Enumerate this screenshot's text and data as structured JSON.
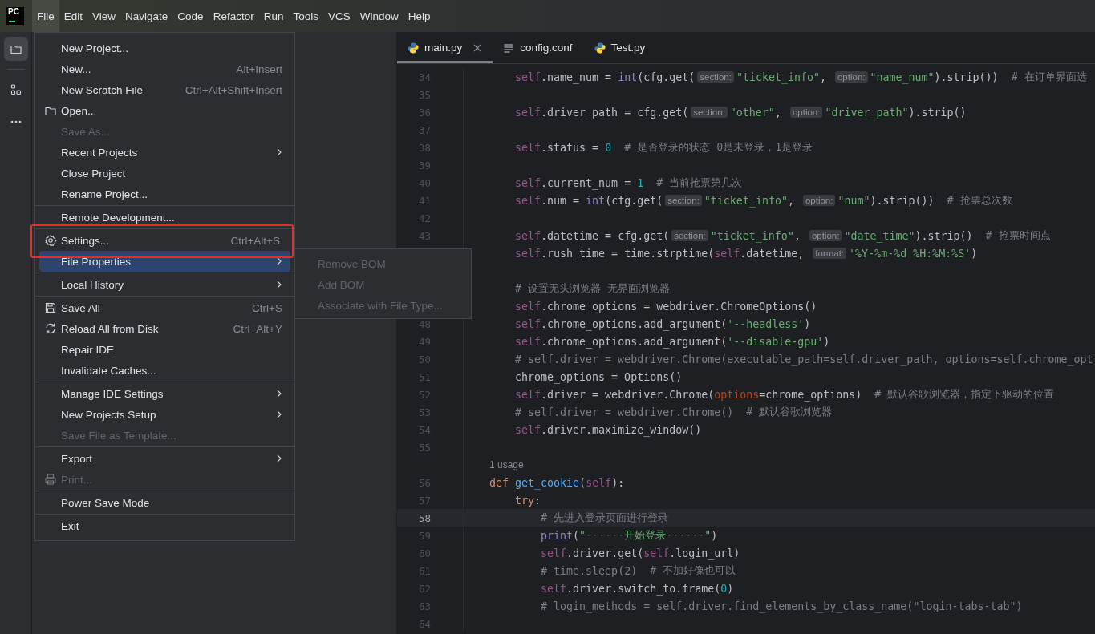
{
  "menu_bar": {
    "logo": "PC",
    "items": [
      {
        "label": "File",
        "selected": true
      },
      {
        "label": "Edit",
        "selected": false
      },
      {
        "label": "View",
        "selected": false
      },
      {
        "label": "Navigate",
        "selected": false
      },
      {
        "label": "Code",
        "selected": false
      },
      {
        "label": "Refactor",
        "selected": false
      },
      {
        "label": "Run",
        "selected": false
      },
      {
        "label": "Tools",
        "selected": false
      },
      {
        "label": "VCS",
        "selected": false
      },
      {
        "label": "Window",
        "selected": false
      },
      {
        "label": "Help",
        "selected": false
      }
    ]
  },
  "tool_strip": {
    "items": [
      {
        "kind": "folder",
        "selected": true
      },
      {
        "kind": "structure",
        "selected": false
      },
      {
        "kind": "more",
        "selected": false
      }
    ]
  },
  "file_menu": {
    "groups": [
      [
        {
          "label": "New Project...",
          "disabled": false,
          "submenu": false,
          "selected": false,
          "annotated": false
        },
        {
          "label": "New...",
          "shortcut": "Alt+Insert",
          "disabled": false,
          "submenu": false,
          "selected": false,
          "annotated": false
        },
        {
          "label": "New Scratch File",
          "shortcut": "Ctrl+Alt+Shift+Insert",
          "disabled": false,
          "submenu": false,
          "selected": false,
          "annotated": false
        },
        {
          "label": "Open...",
          "kind": "folder",
          "disabled": false,
          "submenu": false,
          "selected": false,
          "annotated": false
        },
        {
          "label": "Save As...",
          "disabled": true,
          "submenu": false,
          "selected": false,
          "annotated": false
        },
        {
          "label": "Recent Projects",
          "disabled": false,
          "submenu": true,
          "selected": false,
          "annotated": false
        },
        {
          "label": "Close Project",
          "disabled": false,
          "submenu": false,
          "selected": false,
          "annotated": false
        },
        {
          "label": "Rename Project...",
          "disabled": false,
          "submenu": false,
          "selected": false,
          "annotated": false
        }
      ],
      [
        {
          "label": "Remote Development...",
          "disabled": false,
          "submenu": false,
          "selected": false,
          "annotated": false
        }
      ],
      [
        {
          "label": "Settings...",
          "kind": "gear",
          "shortcut": "Ctrl+Alt+S",
          "disabled": false,
          "submenu": false,
          "selected": false,
          "annotated": true
        },
        {
          "label": "File Properties",
          "disabled": false,
          "submenu": true,
          "selected": true,
          "annotated": false
        }
      ],
      [
        {
          "label": "Local History",
          "disabled": false,
          "submenu": true,
          "selected": false,
          "annotated": false
        }
      ],
      [
        {
          "label": "Save All",
          "kind": "floppy",
          "shortcut": "Ctrl+S",
          "disabled": false,
          "submenu": false,
          "selected": false,
          "annotated": false
        },
        {
          "label": "Reload All from Disk",
          "kind": "reload",
          "shortcut": "Ctrl+Alt+Y",
          "disabled": false,
          "submenu": false,
          "selected": false,
          "annotated": false
        },
        {
          "label": "Repair IDE",
          "disabled": false,
          "submenu": false,
          "selected": false,
          "annotated": false
        },
        {
          "label": "Invalidate Caches...",
          "disabled": false,
          "submenu": false,
          "selected": false,
          "annotated": false
        }
      ],
      [
        {
          "label": "Manage IDE Settings",
          "disabled": false,
          "submenu": true,
          "selected": false,
          "annotated": false
        },
        {
          "label": "New Projects Setup",
          "disabled": false,
          "submenu": true,
          "selected": false,
          "annotated": false
        },
        {
          "label": "Save File as Template...",
          "disabled": true,
          "submenu": false,
          "selected": false,
          "annotated": false
        }
      ],
      [
        {
          "label": "Export",
          "disabled": false,
          "submenu": true,
          "selected": false,
          "annotated": false
        },
        {
          "label": "Print...",
          "kind": "printer",
          "disabled": true,
          "submenu": false,
          "selected": false,
          "annotated": false
        }
      ],
      [
        {
          "label": "Power Save Mode",
          "disabled": false,
          "submenu": false,
          "selected": false,
          "annotated": false
        }
      ],
      [
        {
          "label": "Exit",
          "disabled": false,
          "submenu": false,
          "selected": false,
          "annotated": false
        }
      ]
    ]
  },
  "submenu": {
    "items": [
      {
        "label": "Remove BOM",
        "disabled": true
      },
      {
        "label": "Add BOM",
        "disabled": true
      },
      {
        "label": "Associate with File Type...",
        "disabled": true
      }
    ]
  },
  "editor": {
    "tabs": [
      {
        "label": "main.py",
        "kind": "python",
        "selected": true,
        "closable": true
      },
      {
        "label": "config.conf",
        "kind": "text",
        "selected": false,
        "closable": false
      },
      {
        "label": "Test.py",
        "kind": "python",
        "selected": false,
        "closable": false
      }
    ],
    "lines": [
      {
        "kind": "statement",
        "number": "34",
        "current": false,
        "tokens": [
          {
            "kind": "self",
            "text": "self"
          },
          {
            "kind": "plain",
            "text": ".name_num = "
          },
          {
            "kind": "builtin",
            "text": "int"
          },
          {
            "kind": "plain",
            "text": "(cfg.get("
          },
          {
            "kind": "hint",
            "text": "section:"
          },
          {
            "kind": "string",
            "text": "\"ticket_info\""
          },
          {
            "kind": "plain",
            "text": ", "
          },
          {
            "kind": "hint",
            "text": "option:"
          },
          {
            "kind": "string",
            "text": "\"name_num\""
          },
          {
            "kind": "plain",
            "text": ").strip())"
          },
          {
            "kind": "tail_comment",
            "text": "# 在订单界面选"
          }
        ]
      },
      {
        "kind": "blank",
        "number": "35",
        "current": false
      },
      {
        "kind": "statement",
        "number": "36",
        "current": false,
        "tokens": [
          {
            "kind": "self",
            "text": "self"
          },
          {
            "kind": "plain",
            "text": ".driver_path = cfg.get("
          },
          {
            "kind": "hint",
            "text": "section:"
          },
          {
            "kind": "string",
            "text": "\"other\""
          },
          {
            "kind": "plain",
            "text": ", "
          },
          {
            "kind": "hint",
            "text": "option:"
          },
          {
            "kind": "string",
            "text": "\"driver_path\""
          },
          {
            "kind": "plain",
            "text": ").strip()"
          }
        ]
      },
      {
        "kind": "blank",
        "number": "37",
        "current": false
      },
      {
        "kind": "statement",
        "number": "38",
        "current": false,
        "tokens": [
          {
            "kind": "self",
            "text": "self"
          },
          {
            "kind": "plain",
            "text": ".status = "
          },
          {
            "kind": "number",
            "text": "0"
          },
          {
            "kind": "tail_comment",
            "text": "# 是否登录的状态 0是未登录，1是登录"
          }
        ]
      },
      {
        "kind": "blank",
        "number": "39",
        "current": false
      },
      {
        "kind": "statement",
        "number": "40",
        "current": false,
        "tokens": [
          {
            "kind": "self",
            "text": "self"
          },
          {
            "kind": "plain",
            "text": ".current_num = "
          },
          {
            "kind": "number",
            "text": "1"
          },
          {
            "kind": "tail_comment",
            "text": "# 当前抢票第几次"
          }
        ]
      },
      {
        "kind": "statement",
        "number": "41",
        "current": false,
        "tokens": [
          {
            "kind": "self",
            "text": "self"
          },
          {
            "kind": "plain",
            "text": ".num = "
          },
          {
            "kind": "builtin",
            "text": "int"
          },
          {
            "kind": "plain",
            "text": "(cfg.get("
          },
          {
            "kind": "hint",
            "text": "section:"
          },
          {
            "kind": "string",
            "text": "\"ticket_info\""
          },
          {
            "kind": "plain",
            "text": ", "
          },
          {
            "kind": "hint",
            "text": "option:"
          },
          {
            "kind": "string",
            "text": "\"num\""
          },
          {
            "kind": "plain",
            "text": ").strip())"
          },
          {
            "kind": "tail_comment",
            "text": "# 抢票总次数"
          }
        ]
      },
      {
        "kind": "blank",
        "number": "42",
        "current": false
      },
      {
        "kind": "statement",
        "number": "43",
        "current": false,
        "tokens": [
          {
            "kind": "self",
            "text": "self"
          },
          {
            "kind": "plain",
            "text": ".datetime = cfg.get("
          },
          {
            "kind": "hint",
            "text": "section:"
          },
          {
            "kind": "string",
            "text": "\"ticket_info\""
          },
          {
            "kind": "plain",
            "text": ", "
          },
          {
            "kind": "hint",
            "text": "option:"
          },
          {
            "kind": "string",
            "text": "\"date_time\""
          },
          {
            "kind": "plain",
            "text": ").strip()"
          },
          {
            "kind": "tail_comment",
            "text": "# 抢票时间点"
          }
        ]
      },
      {
        "kind": "statement",
        "current": false,
        "tokens": [
          {
            "kind": "self",
            "text": "self"
          },
          {
            "kind": "plain",
            "text": ".rush_time = time.strptime("
          },
          {
            "kind": "self",
            "text": "self"
          },
          {
            "kind": "plain",
            "text": ".datetime, "
          },
          {
            "kind": "hint",
            "text": "format:"
          },
          {
            "kind": "string",
            "text": "'%Y-%m-%d %H:%M:%S'"
          },
          {
            "kind": "plain",
            "text": ")"
          }
        ]
      },
      {
        "kind": "blank"
      },
      {
        "kind": "statement",
        "current": false,
        "tokens": [
          {
            "kind": "comment",
            "text": "# 设置无头浏览器 无界面浏览器"
          }
        ]
      },
      {
        "kind": "statement",
        "current": false,
        "tokens": [
          {
            "kind": "self",
            "text": "self"
          },
          {
            "kind": "plain",
            "text": ".chrome_options = webdriver.ChromeOptions()"
          }
        ]
      },
      {
        "kind": "statement",
        "number": "48",
        "current": false,
        "tokens": [
          {
            "kind": "self",
            "text": "self"
          },
          {
            "kind": "plain",
            "text": ".chrome_options.add_argument("
          },
          {
            "kind": "string",
            "text": "'--headless'"
          },
          {
            "kind": "plain",
            "text": ")"
          }
        ]
      },
      {
        "kind": "statement",
        "number": "49",
        "current": false,
        "tokens": [
          {
            "kind": "self",
            "text": "self"
          },
          {
            "kind": "plain",
            "text": ".chrome_options.add_argument("
          },
          {
            "kind": "string",
            "text": "'--disable-gpu'"
          },
          {
            "kind": "plain",
            "text": ")"
          }
        ]
      },
      {
        "kind": "statement",
        "number": "50",
        "current": false,
        "tokens": [
          {
            "kind": "comment",
            "text": "# self.driver = webdriver.Chrome(executable_path=self.driver_path, options=self.chrome_opt"
          }
        ]
      },
      {
        "kind": "statement",
        "number": "51",
        "current": false,
        "tokens": [
          {
            "kind": "plain",
            "text": "chrome_options = Options()"
          }
        ]
      },
      {
        "kind": "statement",
        "number": "52",
        "current": false,
        "tokens": [
          {
            "kind": "self",
            "text": "self"
          },
          {
            "kind": "plain",
            "text": ".driver = webdriver.Chrome("
          },
          {
            "kind": "param",
            "text": "options"
          },
          {
            "kind": "plain",
            "text": "=chrome_options)"
          },
          {
            "kind": "tail_comment",
            "text": "# 默认谷歌浏览器，指定下驱动的位置"
          }
        ]
      },
      {
        "kind": "statement",
        "number": "53",
        "current": false,
        "tokens": [
          {
            "kind": "comment",
            "text": "# self.driver = webdriver.Chrome()"
          },
          {
            "kind": "tail_comment",
            "text": "# 默认谷歌浏览器"
          }
        ]
      },
      {
        "kind": "statement",
        "number": "54",
        "current": false,
        "tokens": [
          {
            "kind": "self",
            "text": "self"
          },
          {
            "kind": "plain",
            "text": ".driver.maximize_window()"
          }
        ]
      },
      {
        "kind": "blank",
        "number": "55",
        "current": false
      },
      {
        "kind": "usage",
        "text": "1 usage"
      },
      {
        "kind": "method",
        "number": "56",
        "current": false,
        "tokens": [
          {
            "kind": "keyword",
            "text": "def"
          },
          {
            "kind": "function",
            "text": "get_cookie"
          },
          {
            "kind": "plain",
            "text": "("
          },
          {
            "kind": "self",
            "text": "self"
          },
          {
            "kind": "plain",
            "text": "):"
          }
        ]
      },
      {
        "kind": "statement",
        "number": "57",
        "current": false,
        "tokens": [
          {
            "kind": "keyword",
            "text": "try"
          },
          {
            "kind": "plain",
            "text": ":"
          }
        ]
      },
      {
        "kind": "nested",
        "number": "58",
        "current": true,
        "tokens": [
          {
            "kind": "comment",
            "text": "# 先进入登录页面进行登录"
          }
        ]
      },
      {
        "kind": "nested",
        "number": "59",
        "current": false,
        "tokens": [
          {
            "kind": "builtin",
            "text": "print"
          },
          {
            "kind": "plain",
            "text": "("
          },
          {
            "kind": "string",
            "text": "\"------开始登录------\""
          },
          {
            "kind": "plain",
            "text": ")"
          }
        ]
      },
      {
        "kind": "nested",
        "number": "60",
        "current": false,
        "tokens": [
          {
            "kind": "self",
            "text": "self"
          },
          {
            "kind": "plain",
            "text": ".driver.get("
          },
          {
            "kind": "self",
            "text": "self"
          },
          {
            "kind": "plain",
            "text": ".login_url)"
          }
        ]
      },
      {
        "kind": "nested",
        "number": "61",
        "current": false,
        "tokens": [
          {
            "kind": "comment",
            "text": "# time.sleep(2)"
          },
          {
            "kind": "tail_comment",
            "text": "# 不加好像也可以"
          }
        ]
      },
      {
        "kind": "nested",
        "number": "62",
        "current": false,
        "tokens": [
          {
            "kind": "self",
            "text": "self"
          },
          {
            "kind": "plain",
            "text": ".driver.switch_to.frame("
          },
          {
            "kind": "number",
            "text": "0"
          },
          {
            "kind": "plain",
            "text": ")"
          }
        ]
      },
      {
        "kind": "nested",
        "number": "63",
        "current": false,
        "tokens": [
          {
            "kind": "comment",
            "text": "# login_methods = self.driver.find_elements_by_class_name(\"login-tabs-tab\")"
          }
        ]
      },
      {
        "kind": "blank",
        "number": "64",
        "current": false
      }
    ]
  }
}
